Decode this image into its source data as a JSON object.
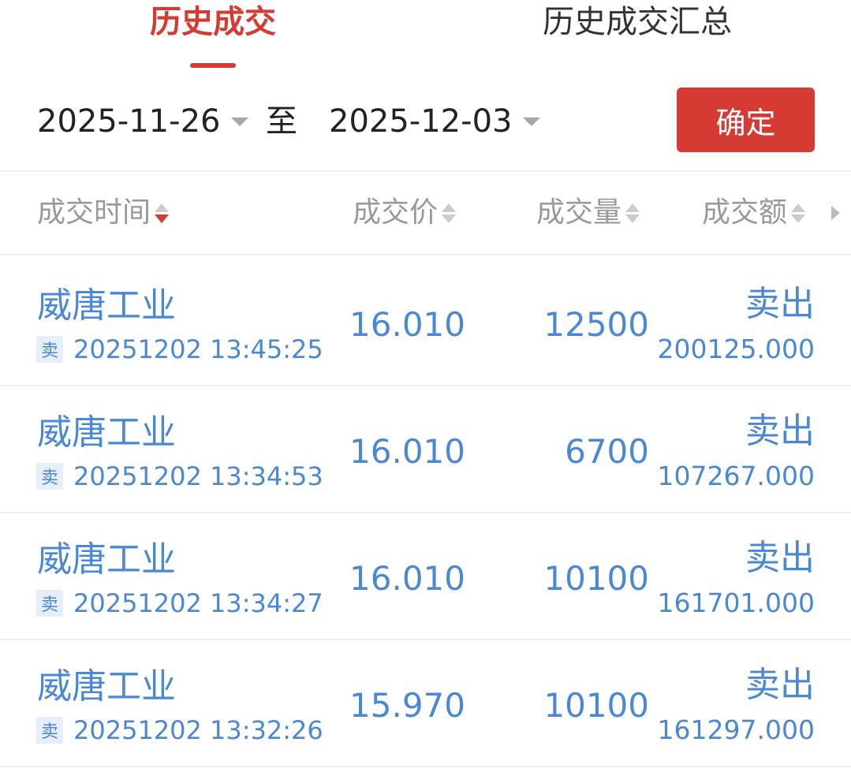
{
  "tabs": [
    {
      "label": "历史成交",
      "active": true
    },
    {
      "label": "历史成交汇总",
      "active": false
    }
  ],
  "date_range": {
    "start": "2025-11-26",
    "separator": "至",
    "end": "2025-12-03",
    "confirm_label": "确定"
  },
  "table": {
    "headers": {
      "time": "成交时间",
      "price": "成交价",
      "volume": "成交量",
      "amount": "成交额"
    },
    "rows": [
      {
        "name": "威唐工业",
        "side_badge": "卖",
        "time": "20251202 13:45:25",
        "price": "16.010",
        "volume": "12500",
        "direction": "卖出",
        "amount": "200125.000"
      },
      {
        "name": "威唐工业",
        "side_badge": "卖",
        "time": "20251202 13:34:53",
        "price": "16.010",
        "volume": "6700",
        "direction": "卖出",
        "amount": "107267.000"
      },
      {
        "name": "威唐工业",
        "side_badge": "卖",
        "time": "20251202 13:34:27",
        "price": "16.010",
        "volume": "10100",
        "direction": "卖出",
        "amount": "161701.000"
      },
      {
        "name": "威唐工业",
        "side_badge": "卖",
        "time": "20251202 13:32:26",
        "price": "15.970",
        "volume": "10100",
        "direction": "卖出",
        "amount": "161297.000"
      }
    ]
  },
  "colors": {
    "accent_red": "#d63b33",
    "data_blue": "#4a87d5",
    "header_gray": "#999999"
  }
}
